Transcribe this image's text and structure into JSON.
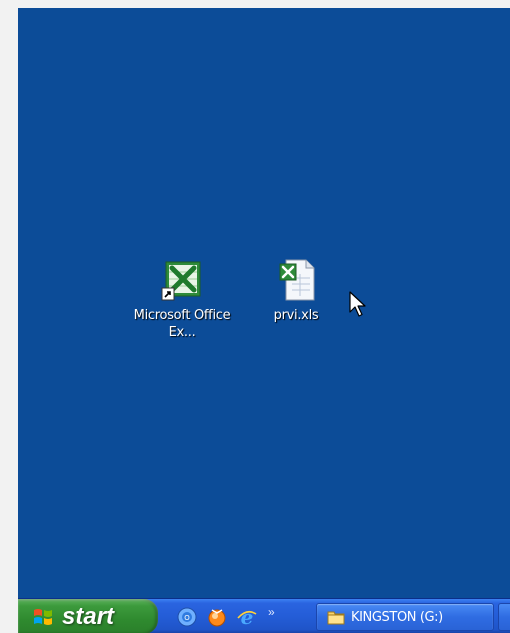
{
  "desktop": {
    "icons": [
      {
        "label": "Microsoft Office Ex...",
        "icon": "excel-shortcut-icon"
      },
      {
        "label": "prvi.xls",
        "icon": "xls-document-icon"
      }
    ]
  },
  "taskbar": {
    "start_label": "start",
    "quick_launch": [
      {
        "icon": "show-desktop-icon"
      },
      {
        "icon": "media-player-icon"
      },
      {
        "icon": "internet-explorer-icon"
      }
    ],
    "more_label": "»",
    "tasks": [
      {
        "label": "KINGSTON (G:)",
        "icon": "folder-icon"
      }
    ]
  },
  "colors": {
    "desktop": "#0c4c98",
    "taskbar": "#245dd7",
    "start_button": "#3c9a3c"
  }
}
